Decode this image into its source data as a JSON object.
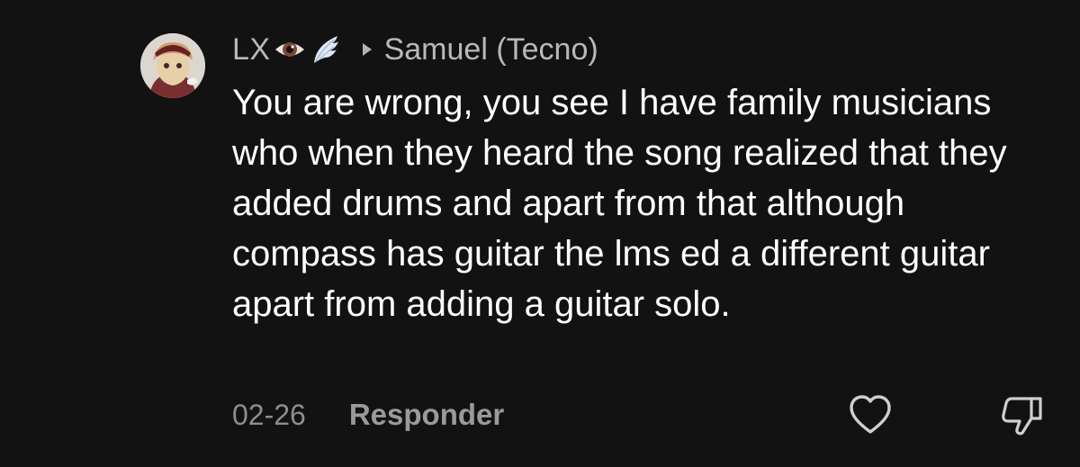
{
  "comment": {
    "username": "LX",
    "username_badges": [
      "eye-icon",
      "wing-icon"
    ],
    "reply_to": "Samuel (Tecno)",
    "text": "You are wrong, you see I have family musicians who when they heard the song realized that they added drums and apart from that although compass has guitar the lms ed a different guitar apart from adding a guitar solo.",
    "timestamp": "02-26",
    "reply_label": "Responder"
  },
  "icons": {
    "like": "heart-outline-icon",
    "dislike": "thumbs-down-outline-icon",
    "reply_arrow": "triangle-right-icon"
  },
  "colors": {
    "background": "#121212",
    "text_primary": "#ffffff",
    "text_secondary": "#b9b9b9",
    "text_muted": "#8e8e8e"
  }
}
